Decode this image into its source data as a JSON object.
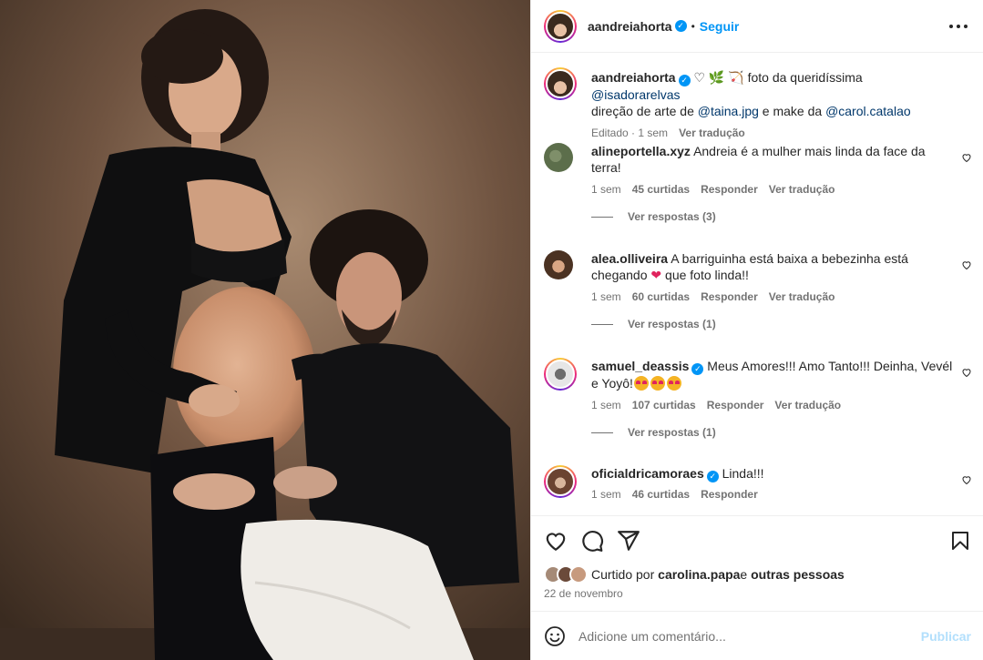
{
  "post": {
    "author": "aandreiahorta",
    "follow_label": "Seguir",
    "more_icon": "more-options-icon"
  },
  "caption": {
    "author": "aandreiahorta",
    "emojis": "♡ 🌿 🏹",
    "text_1": " foto da queridíssima ",
    "mention_1": "@isadorarelvas",
    "text_2": "direção de arte de ",
    "mention_2": "@taina.jpg",
    "text_3": " e make da ",
    "mention_3": "@carol.catalao",
    "edited": "Editado",
    "time": "1 sem",
    "translate": "Ver tradução"
  },
  "comments": [
    {
      "user": "alineportella.xyz",
      "text": "Andreia é a mulher mais linda da face da terra!",
      "time": "1 sem",
      "likes": "45 curtidas",
      "reply": "Responder",
      "translate": "Ver tradução",
      "replies": "Ver respostas (3)"
    },
    {
      "user": "alea.olliveira",
      "text_1": "A barriguinha está baixa a bebezinha está chegando ",
      "heart": "❤",
      "text_2": " que foto linda!!",
      "time": "1 sem",
      "likes": "60 curtidas",
      "reply": "Responder",
      "translate": "Ver tradução",
      "replies": "Ver respostas (1)"
    },
    {
      "user": "samuel_deassis",
      "text": "Meus Amores!!! Amo Tanto!!! Deinha, Vevél e Yoyô!",
      "time": "1 sem",
      "likes": "107 curtidas",
      "reply": "Responder",
      "translate": "Ver tradução",
      "replies": "Ver respostas (1)"
    },
    {
      "user": "oficialdricamoraes",
      "text": "Linda!!!",
      "time": "1 sem",
      "likes": "46 curtidas",
      "reply": "Responder"
    }
  ],
  "footer": {
    "liked_prefix": "Curtido por ",
    "liked_user": "carolina.papa",
    "liked_mid": " e ",
    "liked_others": "outras pessoas",
    "date": "22 de novembro"
  },
  "add_comment": {
    "placeholder": "Adicione um comentário...",
    "publish": "Publicar"
  },
  "colors": {
    "accent": "#0095f6",
    "muted": "#737373",
    "text": "#262626"
  }
}
